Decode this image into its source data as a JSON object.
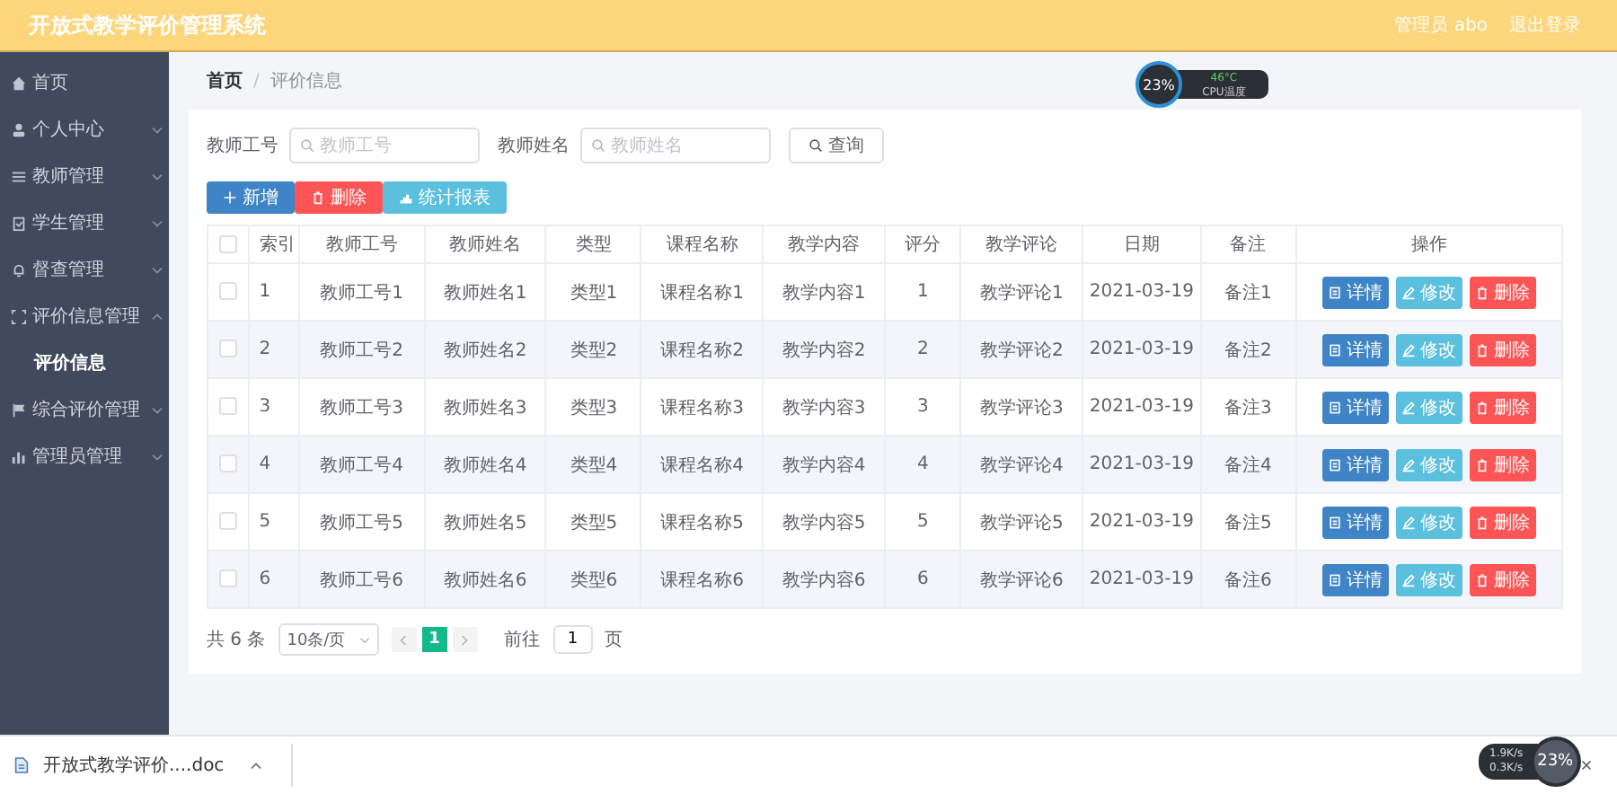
{
  "header": {
    "title": "开放式教学评价管理系统",
    "user": "管理员 abo",
    "logout": "退出登录"
  },
  "sidebar": {
    "items": [
      {
        "label": "首页",
        "kind": "link",
        "selected": false
      },
      {
        "label": "个人中心",
        "kind": "menu",
        "expanded": false,
        "selected": false
      },
      {
        "label": "教师管理",
        "kind": "menu",
        "expanded": false,
        "selected": false
      },
      {
        "label": "学生管理",
        "kind": "menu",
        "expanded": false,
        "selected": false
      },
      {
        "label": "督查管理",
        "kind": "menu",
        "expanded": false,
        "selected": false
      },
      {
        "label": "评价信息管理",
        "kind": "menu",
        "expanded": true,
        "selected": false,
        "children": [
          {
            "label": "评价信息",
            "selected": true
          }
        ]
      },
      {
        "label": "综合评价管理",
        "kind": "menu",
        "expanded": false,
        "selected": false
      },
      {
        "label": "管理员管理",
        "kind": "menu",
        "expanded": false,
        "selected": false
      }
    ]
  },
  "breadcrumb": {
    "separator": "/",
    "items": [
      "首页",
      "评价信息"
    ]
  },
  "search": {
    "fields": [
      {
        "label": "教师工号",
        "placeholder": "教师工号"
      },
      {
        "label": "教师姓名",
        "placeholder": "教师姓名"
      }
    ],
    "button": "查询"
  },
  "toolbar": [
    {
      "kind": "add",
      "label": "新增"
    },
    {
      "kind": "delete",
      "label": "删除"
    },
    {
      "kind": "report",
      "label": "统计报表"
    }
  ],
  "table": {
    "all_checked": false,
    "columns": [
      "索引",
      "教师工号",
      "教师姓名",
      "类型",
      "课程名称",
      "教学内容",
      "评分",
      "教学评论",
      "日期",
      "备注",
      "操作"
    ],
    "rows": [
      {
        "checked": false,
        "cells": [
          "1",
          "教师工号1",
          "教师姓名1",
          "类型1",
          "课程名称1",
          "教学内容1",
          "1",
          "教学评论1",
          "2021-03-19",
          "备注1"
        ],
        "actions": [
          {
            "kind": "detail",
            "label": "详情"
          },
          {
            "kind": "edit",
            "label": "修改"
          },
          {
            "kind": "delete",
            "label": "删除"
          }
        ]
      },
      {
        "checked": false,
        "cells": [
          "2",
          "教师工号2",
          "教师姓名2",
          "类型2",
          "课程名称2",
          "教学内容2",
          "2",
          "教学评论2",
          "2021-03-19",
          "备注2"
        ],
        "actions": [
          {
            "kind": "detail",
            "label": "详情"
          },
          {
            "kind": "edit",
            "label": "修改"
          },
          {
            "kind": "delete",
            "label": "删除"
          }
        ]
      },
      {
        "checked": false,
        "cells": [
          "3",
          "教师工号3",
          "教师姓名3",
          "类型3",
          "课程名称3",
          "教学内容3",
          "3",
          "教学评论3",
          "2021-03-19",
          "备注3"
        ],
        "actions": [
          {
            "kind": "detail",
            "label": "详情"
          },
          {
            "kind": "edit",
            "label": "修改"
          },
          {
            "kind": "delete",
            "label": "删除"
          }
        ]
      },
      {
        "checked": false,
        "cells": [
          "4",
          "教师工号4",
          "教师姓名4",
          "类型4",
          "课程名称4",
          "教学内容4",
          "4",
          "教学评论4",
          "2021-03-19",
          "备注4"
        ],
        "actions": [
          {
            "kind": "detail",
            "label": "详情"
          },
          {
            "kind": "edit",
            "label": "修改"
          },
          {
            "kind": "delete",
            "label": "删除"
          }
        ]
      },
      {
        "checked": false,
        "cells": [
          "5",
          "教师工号5",
          "教师姓名5",
          "类型5",
          "课程名称5",
          "教学内容5",
          "5",
          "教学评论5",
          "2021-03-19",
          "备注5"
        ],
        "actions": [
          {
            "kind": "detail",
            "label": "详情"
          },
          {
            "kind": "edit",
            "label": "修改"
          },
          {
            "kind": "delete",
            "label": "删除"
          }
        ]
      },
      {
        "checked": false,
        "cells": [
          "6",
          "教师工号6",
          "教师姓名6",
          "类型6",
          "课程名称6",
          "教学内容6",
          "6",
          "教学评论6",
          "2021-03-19",
          "备注6"
        ],
        "actions": [
          {
            "kind": "detail",
            "label": "详情"
          },
          {
            "kind": "edit",
            "label": "修改"
          },
          {
            "kind": "delete",
            "label": "删除"
          }
        ]
      }
    ]
  },
  "pagination": {
    "total": "共 6 条",
    "page_size": "10条/页",
    "pages": [
      {
        "label": "1",
        "selected": true
      }
    ],
    "goto_label": "前往",
    "goto_value": "1",
    "goto_suffix": "页"
  },
  "cpu_widget": {
    "percent": "23%",
    "temperature": "46°C",
    "caption": "CPU温度"
  },
  "download_bar": {
    "file": "开放式教学评价....doc"
  },
  "net_widget": {
    "up": "1.9K/s",
    "down": "0.3K/s",
    "percent": "23%"
  }
}
